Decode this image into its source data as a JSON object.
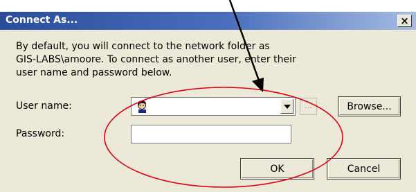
{
  "window": {
    "title": "Connect As...",
    "close_label": "×"
  },
  "description": {
    "line1": "By default, you will connect to the network folder as",
    "line2": "GIS-LABS\\amoore. To connect as another user, enter their",
    "line3": "user name and password below."
  },
  "form": {
    "username_label": "User name:",
    "username_value": "",
    "dots_label": "...",
    "browse_label": "Browse...",
    "password_label": "Password:",
    "password_value": ""
  },
  "buttons": {
    "ok_label": "OK",
    "cancel_label": "Cancel"
  },
  "colors": {
    "titlebar": "#2a4d9a",
    "dialog_bg": "#ece9d8",
    "annotation": "#e0000f"
  },
  "annotations": {
    "ellipse": "red-ellipse-highlight",
    "arrow": "black-arrow-pointer"
  }
}
